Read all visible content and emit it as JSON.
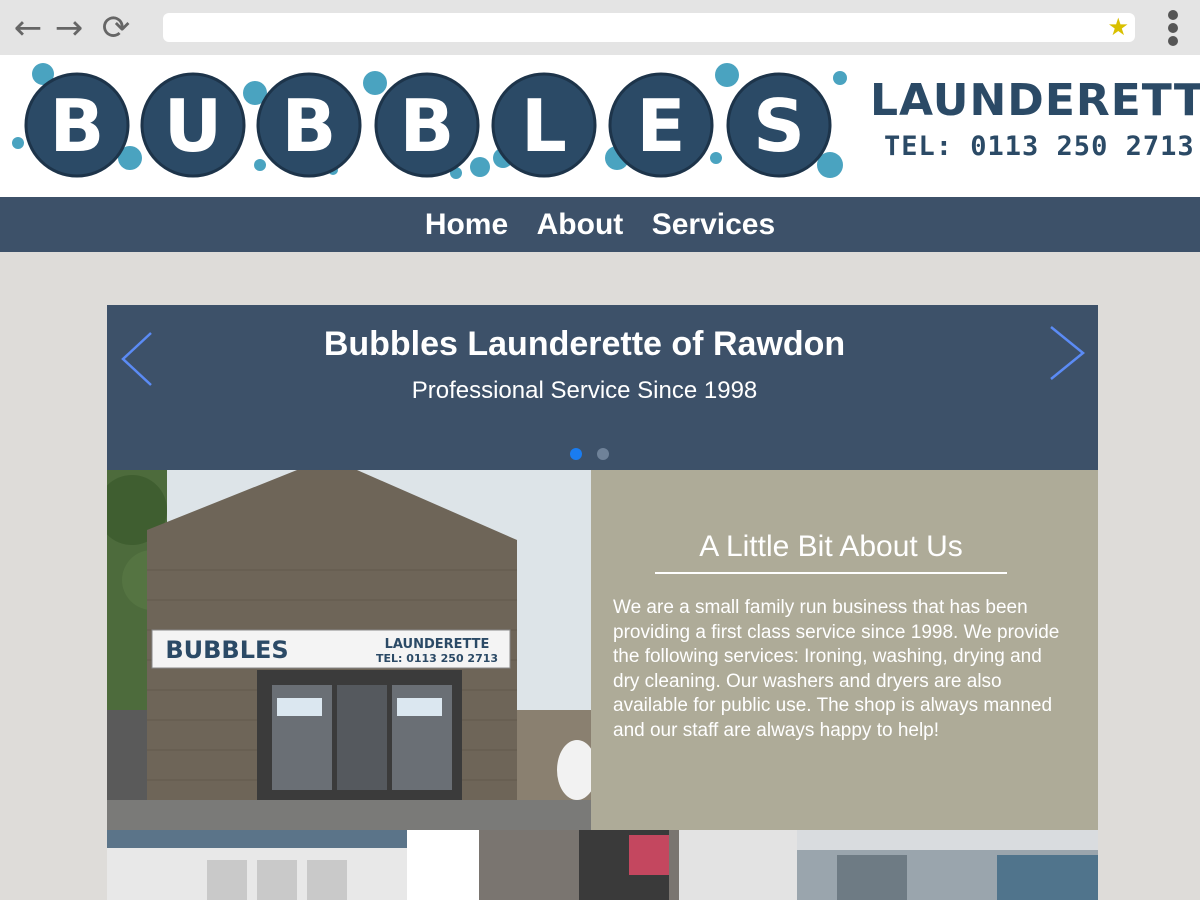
{
  "browser": {
    "back_icon": "back-arrow-icon",
    "forward_icon": "forward-arrow-icon",
    "reload_icon": "reload-icon",
    "url": "",
    "bookmark_icon": "star-icon",
    "menu_icon": "kebab-menu-icon"
  },
  "header": {
    "logo_text": "BUBBLES",
    "brand_word": "LAUNDERETTE",
    "phone": "TEL: 0113 250 2713",
    "logo_color": "#2b4a66",
    "bubble_color": "#4aa3c0"
  },
  "nav": {
    "items": [
      {
        "label": "Home"
      },
      {
        "label": "About"
      },
      {
        "label": "Services"
      }
    ]
  },
  "slider": {
    "title": "Bubbles Launderette of Rawdon",
    "subtitle": "Professional Service Since 1998",
    "prev_icon": "chevron-left-icon",
    "next_icon": "chevron-right-icon",
    "slide_count": 2,
    "active_index": 0,
    "accent": "#1a7cf0"
  },
  "about": {
    "heading": "A Little Bit About Us",
    "body": "We are a small family run business that has been providing a first class service since 1998. We provide the following services: Ironing, washing, drying and dry cleaning. Our washers and dryers are also available for public use. The shop is always manned and our staff are always happy to help!"
  },
  "shopfront_photo": {
    "sign_logo": "BUBBLES",
    "sign_word": "LAUNDERETTE",
    "sign_phone": "TEL: 0113 250 2713"
  },
  "colors": {
    "nav_bg": "#3d5169",
    "page_bg": "#dedcd9",
    "about_bg": "#aeab98"
  }
}
